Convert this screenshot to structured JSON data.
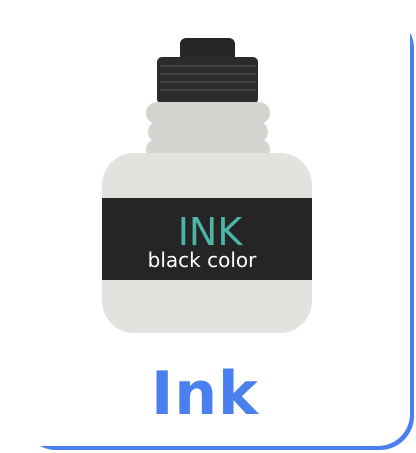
{
  "label": {
    "brand": "INK",
    "subtitle": "black color"
  },
  "title": "Ink",
  "icons": {
    "main": "ink-bottle-icon"
  },
  "colors": {
    "accent": "#4a7ff0",
    "label_text": "#4bb6a8",
    "cap": "#2a2a2a",
    "bottle": "#e2e2de",
    "neck": "#d4d5d0"
  }
}
